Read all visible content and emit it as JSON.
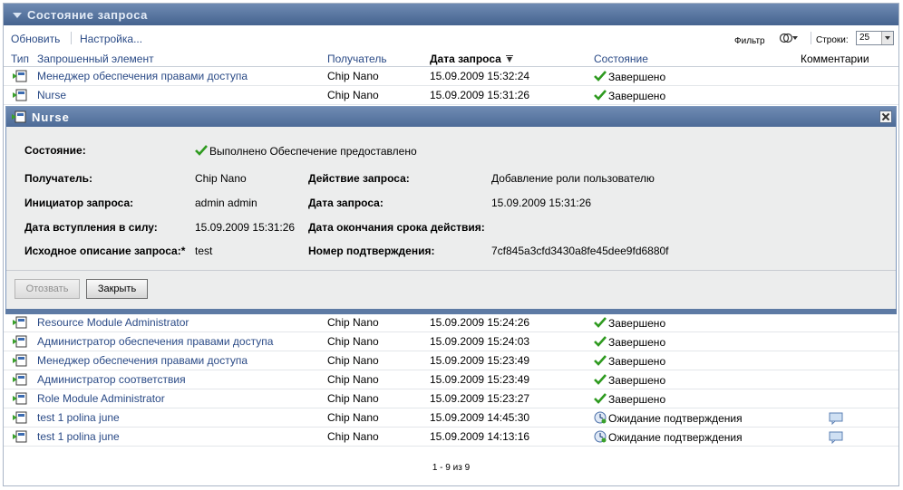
{
  "panel": {
    "title": "Состояние запроса"
  },
  "toolbar": {
    "refresh": "Обновить",
    "settings": "Настройка...",
    "filter": "Фильтр",
    "rows_label": "Строки:",
    "rows_value": "25"
  },
  "columns": {
    "type": "Тип",
    "item": "Запрошенный элемент",
    "recipient": "Получатель",
    "date": "Дата запроса",
    "status": "Состояние",
    "comments": "Комментарии"
  },
  "rows": [
    {
      "item": "Менеджер обеспечения правами доступа",
      "recipient": "Chip Nano",
      "date": "15.09.2009 15:32:24",
      "status": "Завершено",
      "status_kind": "check-icon",
      "comment": false
    },
    {
      "item": "Nurse",
      "recipient": "Chip Nano",
      "date": "15.09.2009 15:31:26",
      "status": "Завершено",
      "status_kind": "check-icon",
      "comment": false
    },
    {
      "item": "Resource Module Administrator",
      "recipient": "Chip Nano",
      "date": "15.09.2009 15:24:26",
      "status": "Завершено",
      "status_kind": "check-icon",
      "comment": false
    },
    {
      "item": "Администратор обеспечения правами доступа",
      "recipient": "Chip Nano",
      "date": "15.09.2009 15:24:03",
      "status": "Завершено",
      "status_kind": "check-icon",
      "comment": false
    },
    {
      "item": "Менеджер обеспечения правами доступа",
      "recipient": "Chip Nano",
      "date": "15.09.2009 15:23:49",
      "status": "Завершено",
      "status_kind": "check-icon",
      "comment": false
    },
    {
      "item": "Администратор соответствия",
      "recipient": "Chip Nano",
      "date": "15.09.2009 15:23:49",
      "status": "Завершено",
      "status_kind": "check-icon",
      "comment": false
    },
    {
      "item": "Role Module Administrator",
      "recipient": "Chip Nano",
      "date": "15.09.2009 15:23:27",
      "status": "Завершено",
      "status_kind": "check-icon",
      "comment": false
    },
    {
      "item": "test 1 polina june",
      "recipient": "Chip Nano",
      "date": "15.09.2009 14:45:30",
      "status": "Ожидание подтверждения",
      "status_kind": "clock-icon",
      "comment": true
    },
    {
      "item": "test 1 polina june",
      "recipient": "Chip Nano",
      "date": "15.09.2009 14:13:16",
      "status": "Ожидание подтверждения",
      "status_kind": "clock-icon",
      "comment": true
    }
  ],
  "detail": {
    "title": "Nurse",
    "status_label": "Состояние:",
    "status_value": "Выполнено Обеспечение предоставлено",
    "recipient_label": "Получатель:",
    "recipient_value": "Chip Nano",
    "action_label": "Действие запроса:",
    "action_value": "Добавление роли пользователю",
    "initiator_label": "Инициатор запроса:",
    "initiator_value": "admin admin",
    "date_label": "Дата запроса:",
    "date_value": "15.09.2009 15:31:26",
    "effective_label": "Дата вступления в силу:",
    "effective_value": "15.09.2009 15:31:26",
    "expiry_label": "Дата окончания срока действия:",
    "expiry_value": "",
    "description_label": "Исходное описание запроса:*",
    "description_value": "test",
    "confirmation_label": "Номер подтверждения:",
    "confirmation_value": "7cf845a3cfd3430a8fe45dee9fd6880f",
    "retract_button": "Отозвать",
    "close_button": "Закрыть"
  },
  "pager": {
    "text": "1 - 9 из 9"
  },
  "colors": {
    "header": "#45638f",
    "link": "#2a4a86",
    "check": "#2e9a1f"
  }
}
